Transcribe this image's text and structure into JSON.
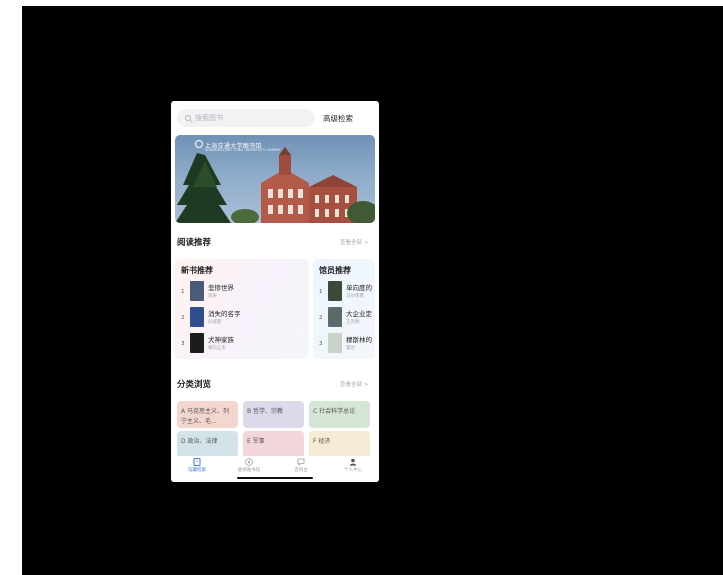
{
  "search": {
    "placeholder": "搜索图书",
    "advanced_label": "高级检索"
  },
  "banner": {
    "logo_text": "上海交通大学图书馆",
    "logo_sub": "SHANGHAI JIAO TONG UNIVERSITY LIBRARY"
  },
  "reading": {
    "title": "阅读推荐",
    "see_all": "查看全部 >",
    "new_books": {
      "title": "新书推荐",
      "items": [
        {
          "rank": "1",
          "name": "悲惨世界",
          "author": "雨果",
          "cover_color": "#4a5a78"
        },
        {
          "rank": "2",
          "name": "消失的名字",
          "author": "旧城客",
          "cover_color": "#2f4f8c"
        },
        {
          "rank": "3",
          "name": "犬神家族",
          "author": "横沟正史",
          "cover_color": "#1c1c1c"
        }
      ]
    },
    "librarian_picks": {
      "title": "馆员推荐",
      "items": [
        {
          "rank": "1",
          "name": "单向度的",
          "author": "马尔库塞",
          "cover_color": "#3d4a3a"
        },
        {
          "rank": "2",
          "name": "大企业定",
          "author": "王克明",
          "cover_color": "#5b6b6a"
        },
        {
          "rank": "3",
          "name": "穆斯林的",
          "author": "霍达",
          "cover_color": "#c9d2c8"
        }
      ]
    }
  },
  "browse": {
    "title": "分类浏览",
    "see_all": "查看全部 >",
    "categories": [
      {
        "label": "A 马克思主义、列宁主义、毛...",
        "color": "#f3d6cd"
      },
      {
        "label": "B 哲学、宗教",
        "color": "#ddd8ea"
      },
      {
        "label": "C 社会科学总论",
        "color": "#d6e6d6"
      },
      {
        "label": "D 政治、法律",
        "color": "#d2e3ea"
      },
      {
        "label": "E 军事",
        "color": "#f2d6dc"
      },
      {
        "label": "F 经济",
        "color": "#f6ecd6"
      }
    ]
  },
  "tabs": [
    {
      "label": "馆藏检索",
      "icon": "book-icon",
      "active": true
    },
    {
      "label": "虚拟图书馆",
      "icon": "compass-icon",
      "active": false
    },
    {
      "label": "咨询台",
      "icon": "chat-icon",
      "active": false
    },
    {
      "label": "个人中心",
      "icon": "person-icon",
      "active": false
    }
  ]
}
